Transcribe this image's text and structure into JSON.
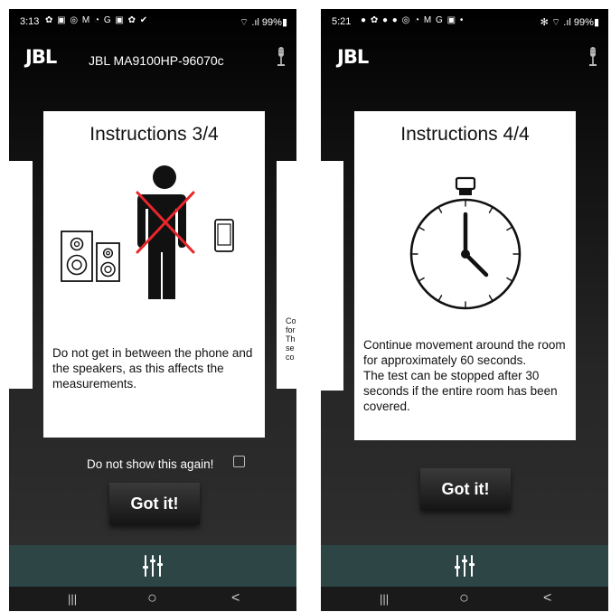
{
  "left": {
    "status": {
      "time": "3:13",
      "icons": "✿ ▣ ◎ M ◔ G ▣ ✿ ✔",
      "right": "⌔ .ıl 99%▮"
    },
    "brand": "JBL",
    "device_name": "JBL MA9100HP-96070c",
    "card": {
      "title": "Instructions 3/4",
      "body": "Do not get in between the phone and  the speakers, as this affects the measurements."
    },
    "side_right_text": "Co\nfor\nTh\nse\nco",
    "dont_show": "Do not show this again!",
    "got_it": "Got it!"
  },
  "right": {
    "status": {
      "time": "5:21",
      "icons": "● ✿ ● ● ◎ ◔ M G ▣ •",
      "right": "✻ ⌔ .ıl 99%▮"
    },
    "brand": "JBL",
    "card": {
      "title": "Instructions 4/4",
      "body": "Continue movement around the room for approximately 60 seconds.\nThe test can be stopped after 30 seconds if the entire room has been covered."
    },
    "got_it": "Got it!"
  },
  "nav": {
    "recents": "|||",
    "home": "○",
    "back": "<"
  },
  "colors": {
    "tabbar": "#2e4546",
    "cross": "#e8262b"
  }
}
